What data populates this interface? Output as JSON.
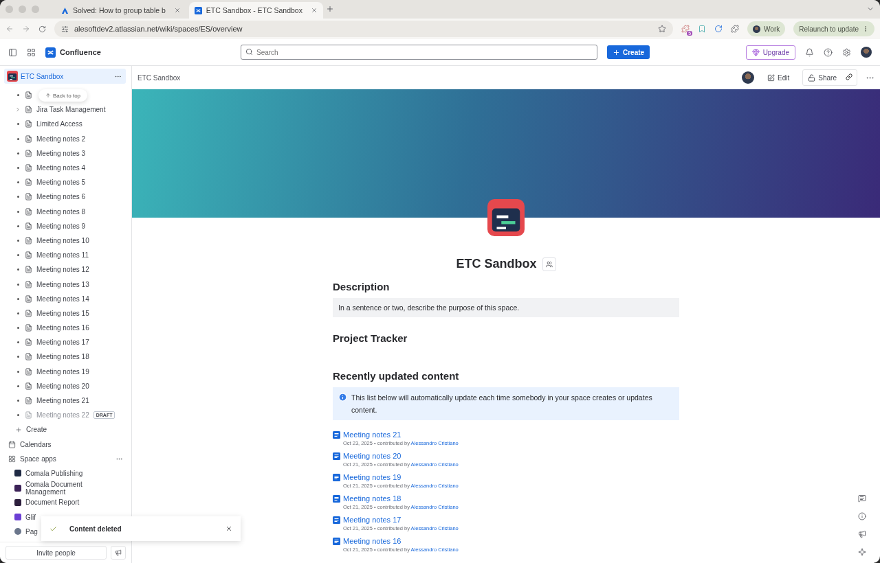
{
  "browser": {
    "tabs": [
      {
        "title": "Solved: How to group table b",
        "selected": false
      },
      {
        "title": "ETC Sandbox - ETC Sandbox",
        "selected": true
      }
    ],
    "url": "alesoftdev2.atlassian.net/wiki/spaces/ES/overview",
    "extension_badge": "5",
    "profile": "Work",
    "relaunch": "Relaunch to update"
  },
  "header": {
    "product": "Confluence",
    "search_placeholder": "Search",
    "create": "Create",
    "upgrade": "Upgrade"
  },
  "sidebar": {
    "space": "ETC Sandbox",
    "tooltip": "Back to top",
    "tree": [
      {
        "expandable": false,
        "draft": false
      },
      {
        "label": "Jira Task Management",
        "expandable": true,
        "draft": false
      },
      {
        "label": "Limited Access",
        "expandable": false,
        "draft": false
      },
      {
        "label": "Meeting notes 2",
        "expandable": false,
        "draft": false
      },
      {
        "label": "Meeting notes 3",
        "expandable": false,
        "draft": false
      },
      {
        "label": "Meeting notes 4",
        "expandable": false,
        "draft": false
      },
      {
        "label": "Meeting notes 5",
        "expandable": false,
        "draft": false
      },
      {
        "label": "Meeting notes 6",
        "expandable": false,
        "draft": false
      },
      {
        "label": "Meeting notes 8",
        "expandable": false,
        "draft": false
      },
      {
        "label": "Meeting notes 9",
        "expandable": false,
        "draft": false
      },
      {
        "label": "Meeting notes 10",
        "expandable": false,
        "draft": false
      },
      {
        "label": "Meeting notes 11",
        "expandable": false,
        "draft": false
      },
      {
        "label": "Meeting notes 12",
        "expandable": false,
        "draft": false
      },
      {
        "label": "Meeting notes 13",
        "expandable": false,
        "draft": false
      },
      {
        "label": "Meeting notes 14",
        "expandable": false,
        "draft": false
      },
      {
        "label": "Meeting notes 15",
        "expandable": false,
        "draft": false
      },
      {
        "label": "Meeting notes 16",
        "expandable": false,
        "draft": false
      },
      {
        "label": "Meeting notes 17",
        "expandable": false,
        "draft": false
      },
      {
        "label": "Meeting notes 18",
        "expandable": false,
        "draft": false
      },
      {
        "label": "Meeting notes 19",
        "expandable": false,
        "draft": false
      },
      {
        "label": "Meeting notes 20",
        "expandable": false,
        "draft": false
      },
      {
        "label": "Meeting notes 21",
        "expandable": false,
        "draft": false
      },
      {
        "label": "Meeting notes 22",
        "expandable": false,
        "draft": true,
        "badge": "DRAFT"
      }
    ],
    "create": "Create",
    "calendars": "Calendars",
    "space_apps": "Space apps",
    "apps": [
      {
        "label": "Comala Publishing",
        "color": "#1f2a44"
      },
      {
        "label": "Comala Document Management",
        "color": "#3b2257"
      },
      {
        "label": "Document Report",
        "color": "#2d1f3d"
      },
      {
        "label": "Glif",
        "color": "#6b3fd4"
      },
      {
        "label": "Pag",
        "color": "#6b778c"
      }
    ],
    "invite": "Invite people"
  },
  "breadcrumb": "ETC Sandbox",
  "actions": {
    "edit": "Edit",
    "share": "Share"
  },
  "page": {
    "title": "ETC Sandbox",
    "description_heading": "Description",
    "description": "In a sentence or two, describe the purpose of this space.",
    "tracker_heading": "Project Tracker",
    "recent_heading": "Recently updated content",
    "info": "This list below will automatically update each time somebody in your space creates or updates content.",
    "recent": [
      {
        "title": "Meeting notes 21",
        "date": "Oct 23, 2025",
        "sep": "•",
        "by": "contributed by",
        "author": "Alessandro Cristiano"
      },
      {
        "title": "Meeting notes 20",
        "date": "Oct 21, 2025",
        "sep": "•",
        "by": "contributed by",
        "author": "Alessandro Cristiano"
      },
      {
        "title": "Meeting notes 19",
        "date": "Oct 21, 2025",
        "sep": "•",
        "by": "contributed by",
        "author": "Alessandro Cristiano"
      },
      {
        "title": "Meeting notes 18",
        "date": "Oct 21, 2025",
        "sep": "•",
        "by": "contributed by",
        "author": "Alessandro Cristiano"
      },
      {
        "title": "Meeting notes 17",
        "date": "Oct 21, 2025",
        "sep": "•",
        "by": "contributed by",
        "author": "Alessandro Cristiano"
      },
      {
        "title": "Meeting notes 16",
        "date": "Oct 21, 2025",
        "sep": "•",
        "by": "contributed by",
        "author": "Alessandro Cristiano"
      }
    ]
  },
  "toast": {
    "message": "Content deleted"
  }
}
